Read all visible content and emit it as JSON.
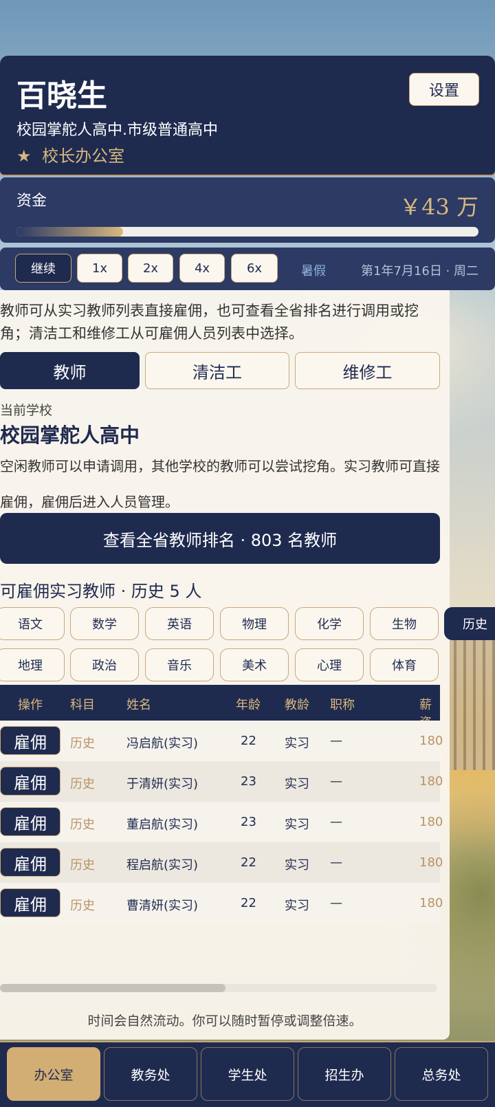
{
  "header": {
    "title": "百晓生",
    "subtitle": "校园掌舵人高中.市级普通高中",
    "office_icon": "★",
    "office": "校长办公室",
    "settings_label": "设置"
  },
  "funds": {
    "label": "资金",
    "value": "￥43 万",
    "progress_percent": 23
  },
  "time_controls": {
    "continue_label": "继续",
    "speeds": [
      "1x",
      "2x",
      "4x",
      "6x"
    ],
    "season": "暑假",
    "date": "第1年7月16日 · 周二"
  },
  "panel": {
    "description": "教师可从实习教师列表直接雇佣，也可查看全省排名进行调用或挖角；清洁工和维修工从可雇佣人员列表中选择。",
    "tabs": [
      "教师",
      "清洁工",
      "维修工"
    ],
    "active_tab": "教师",
    "school_label": "当前学校",
    "school_name": "校园掌舵人高中",
    "school_desc": "空闲教师可以申请调用，其他学校的教师可以尝试挖角。实习教师可直接雇佣，雇佣后进入人员管理。",
    "rank_button": "查看全省教师排名 · 803 名教师",
    "list_title": "可雇佣实习教师 · 历史 5 人",
    "subjects_row1": [
      "语文",
      "数学",
      "英语",
      "物理",
      "化学",
      "生物",
      "历史"
    ],
    "subjects_row2": [
      "地理",
      "政治",
      "音乐",
      "美术",
      "心理",
      "体育"
    ],
    "active_subject": "历史",
    "table": {
      "headers": [
        "操作",
        "科目",
        "姓名",
        "年龄",
        "教龄",
        "职称",
        "薪资"
      ],
      "hire_label": "雇佣",
      "rows": [
        {
          "subject": "历史",
          "name": "冯启航(实习)",
          "age": "22",
          "tenure": "实习",
          "title": "—",
          "salary": "180"
        },
        {
          "subject": "历史",
          "name": "于清妍(实习)",
          "age": "23",
          "tenure": "实习",
          "title": "—",
          "salary": "180"
        },
        {
          "subject": "历史",
          "name": "董启航(实习)",
          "age": "23",
          "tenure": "实习",
          "title": "—",
          "salary": "180"
        },
        {
          "subject": "历史",
          "name": "程启航(实习)",
          "age": "22",
          "tenure": "实习",
          "title": "—",
          "salary": "180"
        },
        {
          "subject": "历史",
          "name": "曹清妍(实习)",
          "age": "22",
          "tenure": "实习",
          "title": "—",
          "salary": "180"
        }
      ]
    },
    "footer_note": "时间会自然流动。你可以随时暂停或调整倍速。"
  },
  "bottom_nav": {
    "items": [
      "办公室",
      "教务处",
      "学生处",
      "招生办",
      "总务处"
    ],
    "active": "办公室"
  },
  "colors": {
    "navy": "#1f2a4f",
    "gold": "#d8b87e",
    "panel": "#faf6ee"
  }
}
